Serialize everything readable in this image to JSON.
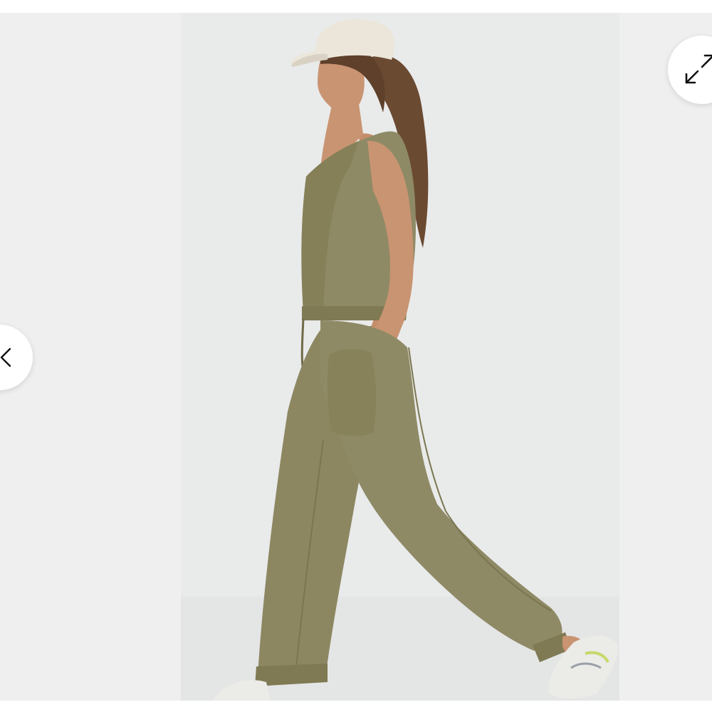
{
  "viewer": {
    "prev_label": "",
    "expand_label": ""
  },
  "image": {
    "subject": "product-photo-olive-jumpsuit",
    "colors": {
      "backdrop": "#e9eaea",
      "side_panels": "#efefef",
      "garment": "#8f8a66",
      "cap": "#ece6da",
      "button_bg": "#ffffff",
      "icon": "#111111"
    }
  },
  "icons": {
    "prev": "chevron-left-icon",
    "expand": "expand-arrows-icon"
  }
}
